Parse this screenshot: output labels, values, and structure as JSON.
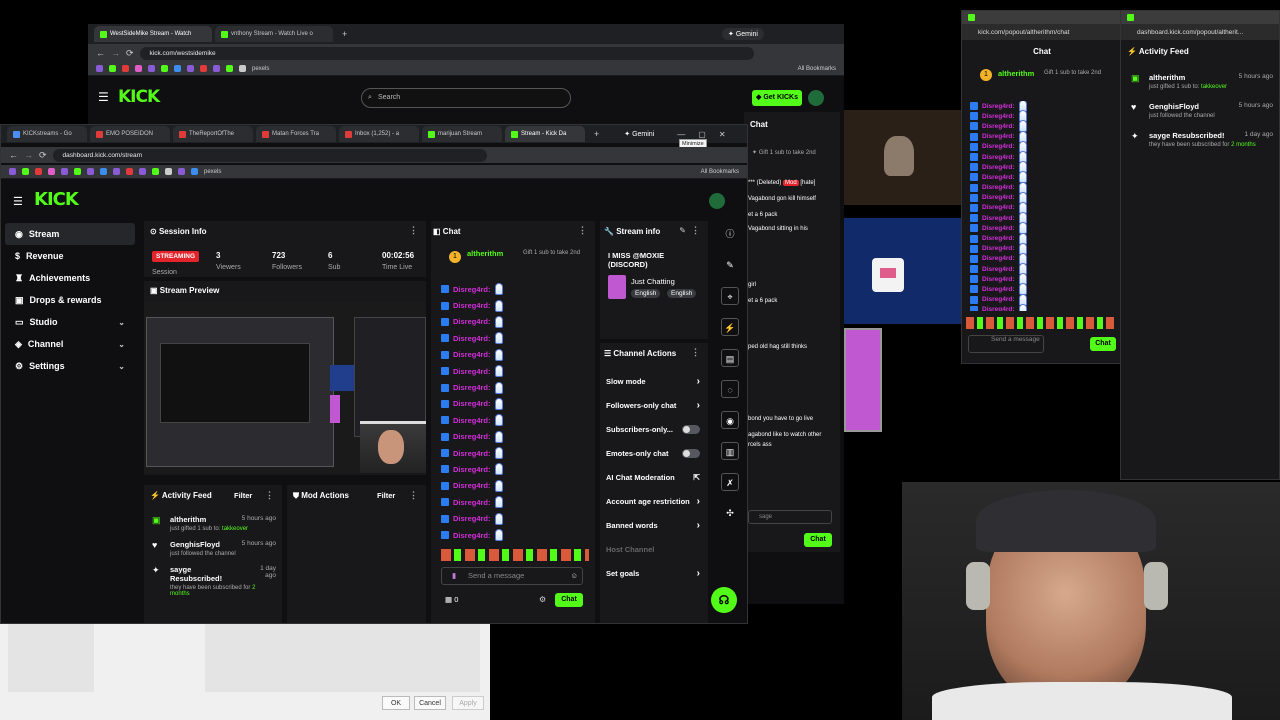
{
  "back_window": {
    "tabs": [
      {
        "label": "WestSideMike Stream - Watch"
      },
      {
        "label": "vnthony Stream - Watch Live o"
      }
    ],
    "gemini": "Gemini",
    "url": "kick.com/westsidemike",
    "search_placeholder": "Search",
    "get_kicks": "Get KICKs",
    "all_bookmarks": "All Bookmarks",
    "pexels": "pexels",
    "chat_title": "Chat",
    "chat_sub": "Gift 1 sub to take 2nd",
    "chat_lines": [
      {
        "text": "*** (Deleted)"
      },
      {
        "text": "Vagabond gon kill himself"
      },
      {
        "text": "et a 6 pack"
      },
      {
        "text": "Vagabond sitting in his"
      },
      {
        "text": "girl"
      },
      {
        "text": "et a 6 pack"
      },
      {
        "text": "ped old hag still thinks"
      },
      {
        "text": "bond you have to go live"
      },
      {
        "text": "agabond like to watch other"
      },
      {
        "text": "rcels ass"
      }
    ],
    "mod_badge": "Mod",
    "hate": "[hate]",
    "send_placeholder": "sage",
    "chat_button": "Chat"
  },
  "popout_chat": {
    "url": "kick.com/popout/altherithm/chat",
    "title": "Chat",
    "pinned_user": "altherithm",
    "pinned_sub": "Gift 1 sub to take 2nd",
    "chat_user": "Disreg4rd:",
    "chat_count": 21,
    "send_placeholder": "Send a message",
    "chat_button": "Chat"
  },
  "popout_feed": {
    "url": "dashboard.kick.com/popout/altherit...",
    "title": "Activity Feed",
    "items": [
      {
        "name": "altherithm",
        "time": "5 hours ago",
        "desc": "just gifted 1 sub to:",
        "target": "takkeover"
      },
      {
        "name": "GenghisFloyd",
        "time": "5 hours ago",
        "desc": "just followed the channel",
        "target": ""
      },
      {
        "name": "sayge Resubscribed!",
        "time": "1 day ago",
        "desc": "they have been subscribed for",
        "target": "2 months"
      }
    ]
  },
  "front_window": {
    "tabs": [
      {
        "label": "KICKstreams - Go"
      },
      {
        "label": "EMO POSEIDON"
      },
      {
        "label": "TheReportOfThe"
      },
      {
        "label": "Matan Forces Tra"
      },
      {
        "label": "Inbox (1,252) - a"
      },
      {
        "label": "marijuan Stream"
      },
      {
        "label": "Stream - Kick Da"
      }
    ],
    "gemini": "Gemini",
    "tooltip": "Minimize",
    "url": "dashboard.kick.com/stream",
    "all_bookmarks": "All Bookmarks",
    "pexels": "pexels",
    "logo": "KICK",
    "sidebar": [
      {
        "label": "Stream",
        "active": true
      },
      {
        "label": "Revenue"
      },
      {
        "label": "Achievements"
      },
      {
        "label": "Drops & rewards"
      },
      {
        "label": "Studio",
        "chevron": true
      },
      {
        "label": "Channel",
        "chevron": true
      },
      {
        "label": "Settings",
        "chevron": true
      }
    ],
    "session": {
      "title": "Session Info",
      "status": "STREAMING",
      "session_label": "Session",
      "stats": [
        {
          "value": "3",
          "label": "Viewers"
        },
        {
          "value": "723",
          "label": "Followers"
        },
        {
          "value": "6",
          "label": "Sub"
        },
        {
          "value": "00:02:56",
          "label": "Time Live"
        }
      ]
    },
    "preview_title": "Stream Preview",
    "activity": {
      "title": "Activity Feed",
      "filter": "Filter",
      "items": [
        {
          "name": "altherithm",
          "time": "5 hours ago",
          "desc": "just gifted 1 sub to:",
          "target": "takkeover"
        },
        {
          "name": "GenghisFloyd",
          "time": "5 hours ago",
          "desc": "just followed the channel",
          "target": ""
        },
        {
          "name": "sayge Resubscribed!",
          "time": "1 day ago",
          "desc": "they have been subscribed for",
          "target": "2 months"
        }
      ]
    },
    "mod_actions": {
      "title": "Mod Actions",
      "filter": "Filter"
    },
    "chat": {
      "title": "Chat",
      "pinned_user": "altherithm",
      "pinned_sub": "Gift 1 sub to take 2nd",
      "chat_user": "Disreg4rd:",
      "chat_count": 16,
      "send_placeholder": "Send a message",
      "count": "0",
      "chat_button": "Chat"
    },
    "stream_info": {
      "title": "Stream info",
      "stream_title": "I MISS @MOXIE (DISCORD)",
      "category": "Just Chatting",
      "tags": [
        "English",
        "English"
      ]
    },
    "channel_actions": {
      "title": "Channel Actions",
      "rows": [
        {
          "label": "Slow mode",
          "kind": "arrow"
        },
        {
          "label": "Followers-only chat",
          "kind": "arrow"
        },
        {
          "label": "Subscribers-only...",
          "kind": "toggle"
        },
        {
          "label": "Emotes-only chat",
          "kind": "toggle"
        },
        {
          "label": "AI Chat Moderation",
          "kind": "ext"
        },
        {
          "label": "Account age restriction",
          "kind": "arrow"
        },
        {
          "label": "Banned words",
          "kind": "arrow"
        },
        {
          "label": "Host Channel",
          "kind": "muted"
        },
        {
          "label": "Set goals",
          "kind": "arrow"
        }
      ]
    }
  },
  "dialog": {
    "ok": "OK",
    "cancel": "Cancel",
    "apply": "Apply"
  },
  "colors": {
    "kick_green": "#53fc18",
    "panel": "#18181b",
    "bg": "#0f0f11",
    "streaming_red": "#e3242b"
  }
}
